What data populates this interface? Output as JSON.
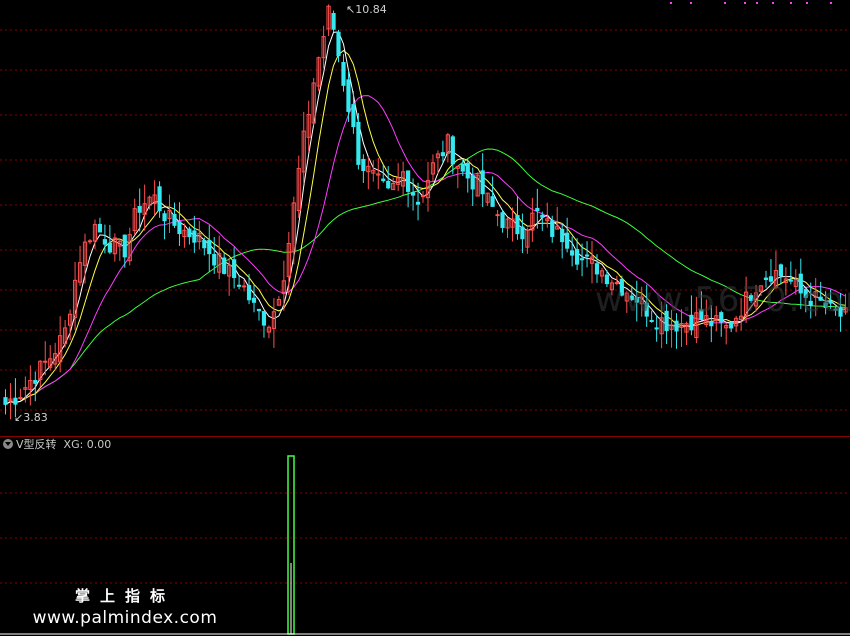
{
  "price_panel": {
    "high_label": "10.84",
    "low_label": "3.83",
    "colors": {
      "up": "#ff4f4f",
      "down": "#35e8f0",
      "ma5": "#ffffff",
      "ma10": "#ffff4a",
      "ma20": "#ff3cff",
      "ma60": "#3cff3c",
      "grid": "#8b0000"
    }
  },
  "indicator": {
    "name": "V型反转",
    "value_text": "XG: 0.00",
    "signal_color": "#40ff40"
  },
  "watermark": {
    "cn": "掌上指标",
    "url": "www.palmindex.com",
    "faint": "www.5670.com"
  },
  "chart_data": {
    "type": "candlestick",
    "price_range": [
      3.83,
      10.84
    ],
    "series_close_profile": [
      4.0,
      4.2,
      4.5,
      4.8,
      5.2,
      6.5,
      7.1,
      6.8,
      6.6,
      7.4,
      7.6,
      7.2,
      7.0,
      6.9,
      6.6,
      6.3,
      6.1,
      5.6,
      5.4,
      6.4,
      8.2,
      9.7,
      10.84,
      9.5,
      8.2,
      7.9,
      7.6,
      8.0,
      7.5,
      8.1,
      8.5,
      8.0,
      7.8,
      7.4,
      7.1,
      7.0,
      7.3,
      7.0,
      6.9,
      6.5,
      6.4,
      6.2,
      6.0,
      5.8,
      5.5,
      5.4,
      5.4,
      5.5,
      5.4,
      5.3,
      5.7,
      6.1,
      6.3,
      6.2,
      5.9,
      5.8,
      5.6,
      5.5
    ],
    "ma_lines": [
      "MA5",
      "MA10",
      "MA20",
      "MA60"
    ],
    "signal_bar_index": 19
  }
}
